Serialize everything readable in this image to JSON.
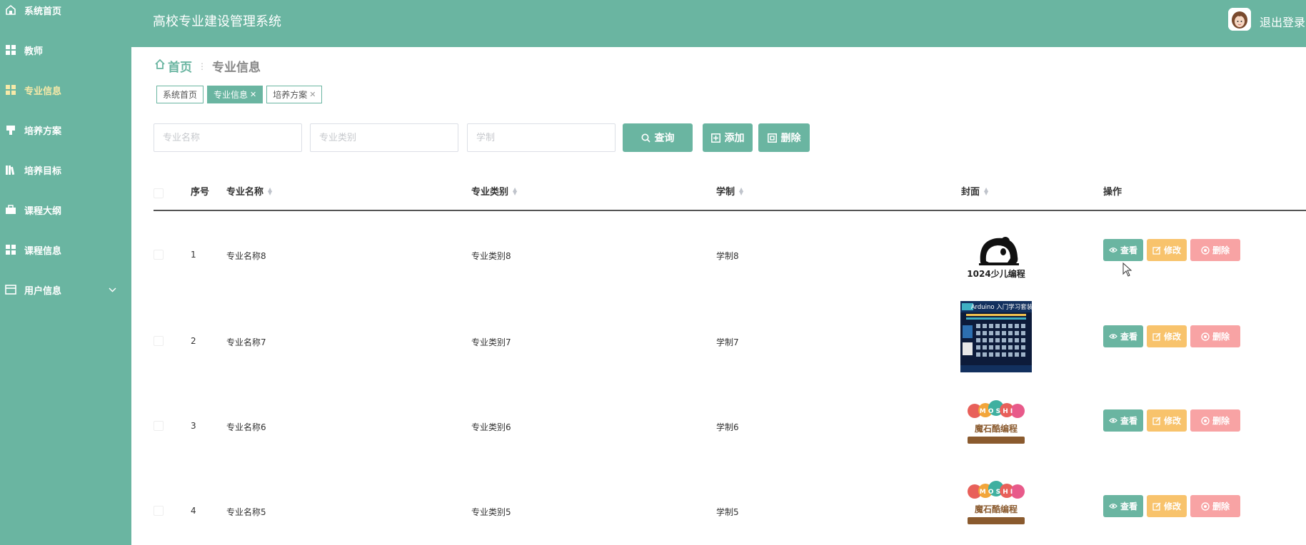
{
  "app": {
    "title": "高校专业建设管理系统",
    "logout_label": "退出登录"
  },
  "sidebar": {
    "items": [
      {
        "label": "系统首页",
        "icon": "home-icon",
        "active": false
      },
      {
        "label": "教师",
        "icon": "grid-icon",
        "active": false
      },
      {
        "label": "专业信息",
        "icon": "grid-icon",
        "active": true
      },
      {
        "label": "培养方案",
        "icon": "signpost-icon",
        "active": false
      },
      {
        "label": "培养目标",
        "icon": "library-icon",
        "active": false
      },
      {
        "label": "课程大纲",
        "icon": "briefcase-icon",
        "active": false
      },
      {
        "label": "课程信息",
        "icon": "grid-icon",
        "active": false
      },
      {
        "label": "用户信息",
        "icon": "window-icon",
        "active": false,
        "has_submenu": true
      }
    ]
  },
  "breadcrumb": {
    "home": "首页",
    "current": "专业信息"
  },
  "tags": [
    {
      "label": "系统首页",
      "active": false,
      "closable": false
    },
    {
      "label": "专业信息",
      "active": true,
      "closable": true
    },
    {
      "label": "培养方案",
      "active": false,
      "closable": true
    }
  ],
  "search": {
    "name_placeholder": "专业名称",
    "type_placeholder": "专业类别",
    "system_placeholder": "学制",
    "query_label": "查询",
    "add_label": "添加",
    "delete_label": "删除"
  },
  "table": {
    "headers": {
      "index": "序号",
      "name": "专业名称",
      "type": "专业类别",
      "system": "学制",
      "cover": "封面",
      "actions": "操作"
    },
    "action_labels": {
      "view": "查看",
      "edit": "修改",
      "delete": "删除"
    },
    "rows": [
      {
        "index": "1",
        "name": "专业名称8",
        "type": "专业类别8",
        "system": "学制8",
        "cover": "panda-logo",
        "cover_text": "1024少儿编程"
      },
      {
        "index": "2",
        "name": "专业名称7",
        "type": "专业类别7",
        "system": "学制7",
        "cover": "arduino-kit",
        "cover_text": "Arduino 入门学习套装"
      },
      {
        "index": "3",
        "name": "专业名称6",
        "type": "专业类别6",
        "system": "学制6",
        "cover": "moshi-logo",
        "cover_text": "魔石酷编程"
      },
      {
        "index": "4",
        "name": "专业名称5",
        "type": "专业类别5",
        "system": "学制5",
        "cover": "moshi-logo",
        "cover_text": "魔石酷编程"
      }
    ]
  },
  "colors": {
    "primary": "#6ab5a1",
    "active_menu": "#f7e9a8",
    "edit": "#f8c36c",
    "delete": "#f8a3a4"
  }
}
